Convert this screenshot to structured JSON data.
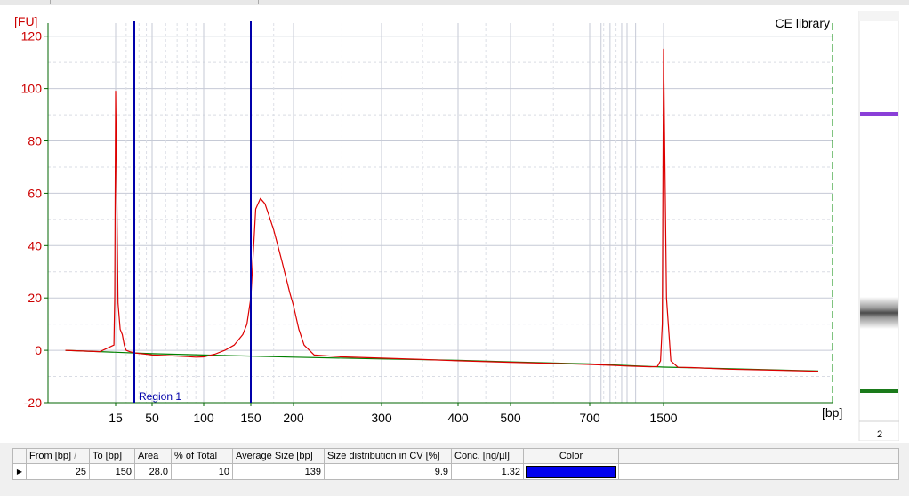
{
  "chart_data": {
    "type": "line",
    "title": "CE library",
    "ylabel": "[FU]",
    "xlabel": "[bp]",
    "ylim": [
      -20,
      125
    ],
    "y_ticks": [
      -20,
      0,
      20,
      40,
      60,
      80,
      100,
      120
    ],
    "x_scale": "ladder-calibrated (non-linear)",
    "x_ticks": [
      15,
      50,
      100,
      150,
      200,
      300,
      400,
      500,
      700,
      1500
    ],
    "x_tick_labels": [
      "15",
      "50",
      "100",
      "150",
      "200",
      "300",
      "400",
      "500",
      "700",
      "1500"
    ],
    "series": [
      {
        "color": "#dd0000",
        "x": [
          2,
          8,
          14,
          14.5,
          15,
          15.5,
          16,
          17,
          18,
          19,
          20,
          22,
          25,
          30,
          40,
          50,
          60,
          70,
          80,
          90,
          100,
          110,
          120,
          130,
          140,
          145,
          150,
          155,
          160,
          165,
          170,
          175,
          180,
          185,
          190,
          195,
          200,
          205,
          210,
          220,
          250,
          300,
          350,
          400,
          500,
          600,
          700,
          800,
          900,
          1000,
          1200,
          1300,
          1400,
          1450,
          1480,
          1500,
          1520,
          1550,
          1600,
          1700,
          1800,
          2000,
          2500,
          3000
        ],
        "y": [
          0,
          -0.5,
          2,
          20,
          99,
          60,
          18,
          8,
          6,
          2,
          0,
          -0.5,
          -1,
          -1.2,
          -1.5,
          -1.8,
          -2,
          -2.2,
          -2.4,
          -2.6,
          -2.5,
          -1.5,
          0,
          2,
          6,
          10,
          20,
          54,
          58,
          56,
          51,
          46,
          40,
          34,
          28,
          22,
          17,
          8,
          2,
          -1.8,
          -2.5,
          -3,
          -3.5,
          -4,
          -4.6,
          -5,
          -5.4,
          -5.6,
          -5.8,
          -6,
          -6.2,
          -6.3,
          -6.2,
          -4,
          10,
          115,
          20,
          -4,
          -6.5,
          -6.6,
          -6.8,
          -7.2,
          -7.6,
          -8
        ]
      },
      {
        "color": "#008000",
        "x": [
          2,
          50,
          100,
          150,
          200,
          300,
          400,
          500,
          700,
          1000,
          1500,
          2000,
          3000
        ],
        "y": [
          0,
          -1.3,
          -1.8,
          -2.2,
          -2.6,
          -3.3,
          -3.8,
          -4.4,
          -5.2,
          -5.8,
          -6.4,
          -7.0,
          -7.9
        ]
      }
    ],
    "annotations": [
      {
        "label": "Region 1",
        "x": 25,
        "type": "region-start"
      },
      {
        "label": "",
        "x": 150,
        "type": "region-end"
      }
    ],
    "grid": true
  },
  "gel": {
    "lane_label": "2",
    "bands": [
      {
        "name": "upper-marker",
        "color": "#8a3fd8"
      },
      {
        "name": "library",
        "color": "#5a5a5a"
      },
      {
        "name": "lower-marker",
        "color": "#1a7a1a"
      }
    ]
  },
  "table": {
    "headers": [
      "From [bp]",
      "To [bp]",
      "Area",
      "% of Total",
      "Average Size [bp]",
      "Size distribution in CV [%]",
      "Conc. [ng/µl]",
      "Color"
    ],
    "sort_marker": "/",
    "rows": [
      {
        "from": "25",
        "to": "150",
        "area": "28.0",
        "pct_total": "10",
        "avg_size": "139",
        "cv": "9.9",
        "conc": "1.32",
        "color": "#0000ee"
      }
    ]
  }
}
